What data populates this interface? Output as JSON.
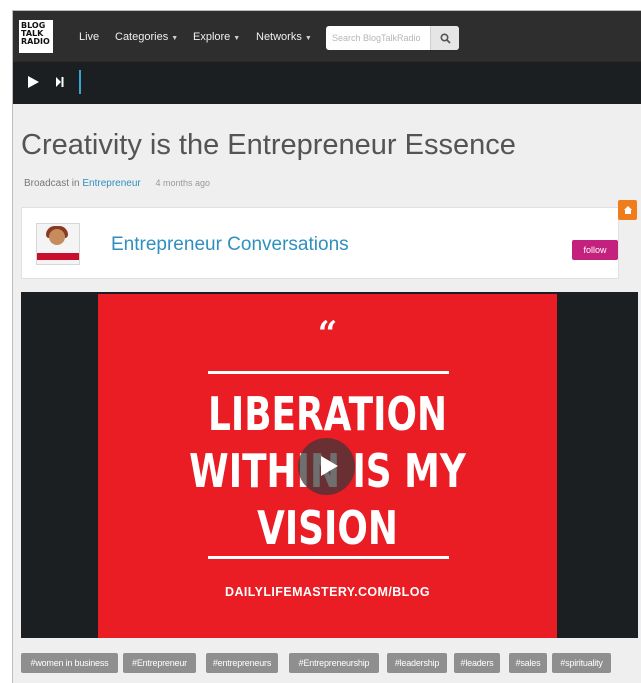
{
  "header": {
    "logo_text": "BLOG\nTALK\nRADIO",
    "nav": [
      {
        "label": "Live",
        "dropdown": false
      },
      {
        "label": "Categories",
        "dropdown": true
      },
      {
        "label": "Explore",
        "dropdown": true
      },
      {
        "label": "Networks",
        "dropdown": true
      }
    ],
    "search": {
      "placeholder": "Search BlogTalkRadio",
      "icon": "search-icon"
    }
  },
  "player_bar": {
    "play_icon": "play-icon",
    "next_icon": "skip-next-icon",
    "accent_color": "#33a8d6"
  },
  "episode": {
    "title": "Creativity is the Entrepreneur Essence",
    "broadcast_prefix": "Broadcast in",
    "category": "Entrepreneur",
    "age": "4 months ago"
  },
  "show": {
    "name": "Entrepreneur Conversations",
    "follow_label": "follow",
    "follow_color": "#c4207e",
    "badge_icon": "home-icon",
    "badge_color": "#f07d1c"
  },
  "media": {
    "quote_mark": "“",
    "headline_lines": [
      "LIBERATION",
      "WITHIN IS MY",
      "VISION"
    ],
    "url_text": "DAILYLIFEMASTERY.COM/BLOG",
    "background_color": "#ea1c24",
    "play_icon": "play-icon"
  },
  "tags": [
    "#women in business",
    "#Entrepreneur",
    "#entrepreneurs",
    "#Entrepreneurship",
    "#leadership",
    "#leaders",
    "#sales",
    "#spirituality"
  ]
}
